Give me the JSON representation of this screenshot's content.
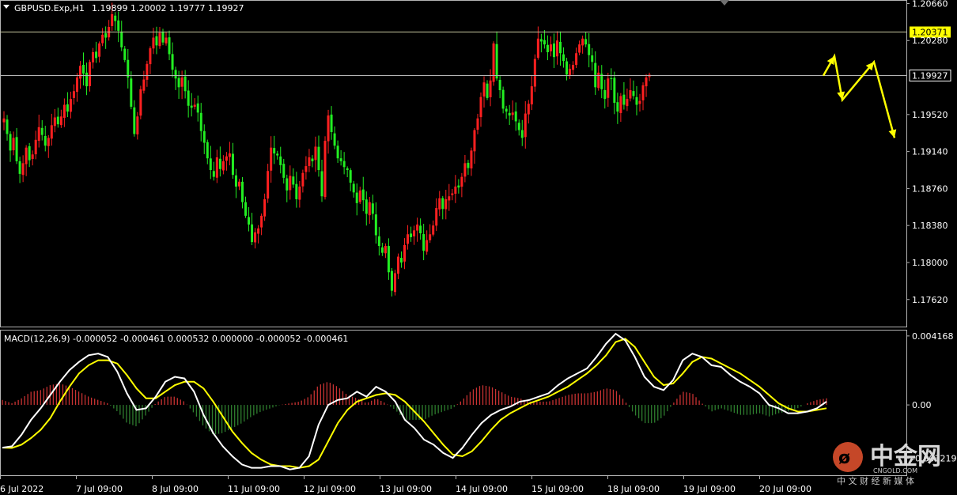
{
  "header": {
    "symbol_label": "GBPUSD.Exp,H1",
    "ohlc_label": "1.19899 1.20002 1.19777 1.19927"
  },
  "macd": {
    "label": "MACD(12,26,9) -0.000052 -0.000461 0.000532 0.000000 -0.000052 -0.000461"
  },
  "watermark": {
    "name": "中金网",
    "sub": "CNGOLD.COM",
    "tagline": "中 文 财 经 新 媒 体"
  },
  "colors": {
    "background": "#000000",
    "bull": "#ff2020",
    "bear": "#22ee22",
    "grid": "#b4b4b4",
    "macd_main": "#ffffff",
    "macd_signal": "#ffff00",
    "hist_pos": "#c83232",
    "hist_neg": "#2e7d2e",
    "arrow": "#ffff00",
    "level_highlight": "#ffff00"
  },
  "chart_data": [
    {
      "type": "candlestick",
      "title": "GBPUSD.Exp,H1",
      "ylim": [
        1.1735,
        1.2068
      ],
      "y_ticks": [
        "1.20660",
        "1.20280",
        "1.19520",
        "1.19140",
        "1.18760",
        "1.18380",
        "1.18000",
        "1.17620"
      ],
      "y_tick_values": [
        1.2066,
        1.2028,
        1.1952,
        1.1914,
        1.1876,
        1.1838,
        1.18,
        1.1762
      ],
      "x_ticks": [
        "6 Jul 2022",
        "7 Jul 09:00",
        "8 Jul 09:00",
        "11 Jul 09:00",
        "12 Jul 09:00",
        "13 Jul 09:00",
        "14 Jul 09:00",
        "15 Jul 09:00",
        "18 Jul 09:00",
        "19 Jul 09:00",
        "20 Jul 09:00"
      ],
      "x_tick_index": [
        0,
        24,
        48,
        72,
        96,
        120,
        144,
        168,
        192,
        216,
        240
      ],
      "levels": [
        {
          "value": 1.20371,
          "label": "1.20371",
          "highlight": true
        },
        {
          "value": 1.19927,
          "label": "1.19927",
          "highlight": false
        }
      ],
      "guide_points": [
        [
          1.1992,
          1.2012,
          1.1967,
          1.2006,
          1.1928
        ]
      ],
      "close": [
        1.1948,
        1.1932,
        1.1915,
        1.1928,
        1.1904,
        1.1891,
        1.1902,
        1.1918,
        1.1905,
        1.1911,
        1.1926,
        1.1939,
        1.1931,
        1.192,
        1.1928,
        1.1941,
        1.1949,
        1.1942,
        1.195,
        1.1962,
        1.1955,
        1.1968,
        1.1976,
        1.199,
        1.2002,
        1.1994,
        1.1981,
        1.2006,
        1.2016,
        1.201,
        1.2025,
        1.2034,
        1.2031,
        1.2042,
        1.2055,
        1.2048,
        1.2038,
        1.2021,
        1.2008,
        1.199,
        1.196,
        1.1932,
        1.195,
        1.1978,
        1.1988,
        1.2004,
        1.202,
        1.2031,
        1.2023,
        1.2036,
        1.2026,
        1.2031,
        1.2014,
        1.1998,
        1.1989,
        1.198,
        1.199,
        1.1976,
        1.1961,
        1.1959,
        1.1962,
        1.1954,
        1.1935,
        1.1923,
        1.1907,
        1.1895,
        1.1888,
        1.1908,
        1.1896,
        1.1904,
        1.1909,
        1.1912,
        1.189,
        1.1878,
        1.1883,
        1.1862,
        1.1848,
        1.1839,
        1.1821,
        1.1831,
        1.1835,
        1.1848,
        1.1865,
        1.1894,
        1.1918,
        1.1912,
        1.191,
        1.19,
        1.1887,
        1.1874,
        1.1889,
        1.188,
        1.1865,
        1.1878,
        1.1892,
        1.1899,
        1.1908,
        1.1904,
        1.1919,
        1.1895,
        1.1868,
        1.1925,
        1.1951,
        1.1934,
        1.192,
        1.1907,
        1.1904,
        1.1898,
        1.1895,
        1.1882,
        1.1872,
        1.1861,
        1.1874,
        1.1864,
        1.185,
        1.1862,
        1.185,
        1.1828,
        1.1817,
        1.181,
        1.1817,
        1.179,
        1.1771,
        1.1789,
        1.1806,
        1.18,
        1.1818,
        1.1829,
        1.1826,
        1.1833,
        1.1839,
        1.183,
        1.1812,
        1.1823,
        1.1829,
        1.1838,
        1.1856,
        1.1866,
        1.1855,
        1.1865,
        1.1868,
        1.1871,
        1.1878,
        1.1877,
        1.1888,
        1.1902,
        1.1897,
        1.1915,
        1.1936,
        1.1948,
        1.197,
        1.1985,
        1.1969,
        1.1987,
        1.2025,
        1.1989,
        1.1977,
        1.1958,
        1.1955,
        1.1951,
        1.1954,
        1.1945,
        1.1936,
        1.1928,
        1.1953,
        1.1963,
        1.1981,
        1.2009,
        1.203,
        1.2027,
        1.2024,
        1.2016,
        1.2024,
        1.2011,
        1.2028,
        1.2015,
        1.2007,
        1.1993,
        1.1999,
        1.2003,
        1.2015,
        1.2024,
        1.203,
        1.2024,
        1.2013,
        1.2006,
        1.198,
        1.1995,
        1.1978,
        1.1968,
        1.1989,
        1.1989,
        1.1964,
        1.1955,
        1.1971,
        1.1962,
        1.1968,
        1.1977,
        1.1971,
        1.1962,
        1.1966,
        1.1982,
        1.199,
        1.1993
      ],
      "series": [
        {
          "name": "MACD main",
          "values": [
            -0.00258,
            -0.0025,
            -0.0018,
            -0.0009,
            -0.0002,
            0.0006,
            0.0014,
            0.0021,
            0.0026,
            0.003,
            0.0031,
            0.0029,
            0.002,
            0.0007,
            -0.0003,
            -0.0002,
            0.0005,
            0.0014,
            0.0017,
            0.0016,
            0.0008,
            -0.0006,
            -0.0017,
            -0.0025,
            -0.0031,
            -0.0036,
            -0.0038,
            -0.0038,
            -0.0037,
            -0.0037,
            -0.0039,
            -0.0038,
            -0.0031,
            -0.0012,
            0,
            0.0003,
            0.0004,
            0.0008,
            0.0005,
            0.0011,
            0.0008,
            0.0002,
            -0.0009,
            -0.0014,
            -0.0021,
            -0.0024,
            -0.0029,
            -0.0032,
            -0.0026,
            -0.0018,
            -0.0011,
            -0.0006,
            -0.0003,
            -0.0001,
            0.0002,
            0.0003,
            0.0005,
            0.0007,
            0.0012,
            0.0016,
            0.0019,
            0.0022,
            0.0029,
            0.0037,
            0.0043,
            0.0039,
            0.0029,
            0.0017,
            0.0011,
            0.0009,
            0.0015,
            0.0027,
            0.0031,
            0.0029,
            0.0024,
            0.0023,
            0.0018,
            0.0014,
            0.0011,
            0.0007,
            0,
            -0.0002,
            -0.0005,
            -0.0005,
            -0.0004,
            -0.0002,
            0.0002
          ]
        },
        {
          "name": "MACD signal",
          "values": [
            -0.00258,
            -0.0026,
            -0.0024,
            -0.002,
            -0.0015,
            -0.0008,
            0.0002,
            0.0011,
            0.0019,
            0.0024,
            0.0027,
            0.0027,
            0.0025,
            0.0018,
            0.001,
            0.0004,
            0.0004,
            0.0008,
            0.0012,
            0.0014,
            0.0014,
            0.001,
            0.0002,
            -0.0007,
            -0.0016,
            -0.0023,
            -0.0029,
            -0.0033,
            -0.0036,
            -0.0037,
            -0.0037,
            -0.0038,
            -0.0037,
            -0.0033,
            -0.0022,
            -0.0011,
            -0.0003,
            0.0002,
            0.0004,
            0.0006,
            0.0007,
            0.0006,
            0.0002,
            -0.0004,
            -0.001,
            -0.0017,
            -0.0024,
            -0.003,
            -0.0031,
            -0.0028,
            -0.0022,
            -0.0015,
            -0.0009,
            -0.0005,
            -0.0002,
            0.0001,
            0.0003,
            0.0005,
            0.0008,
            0.0011,
            0.0015,
            0.0019,
            0.0024,
            0.003,
            0.0038,
            0.004,
            0.0035,
            0.0026,
            0.0017,
            0.0012,
            0.0013,
            0.0019,
            0.0026,
            0.0029,
            0.0028,
            0.0025,
            0.0022,
            0.0019,
            0.0015,
            0.0011,
            0.0006,
            0.0001,
            -0.0002,
            -0.0004,
            -0.0004,
            -0.0003,
            -0.0002
          ]
        },
        {
          "name": "histogram",
          "values": [
            0.0003,
            0.0001,
            0.0004,
            0.0008,
            0.0009,
            0.0012,
            0.0013,
            0.0011,
            0.0008,
            0.0005,
            0.0003,
            0.0001,
            -0.0004,
            -0.0011,
            -0.0013,
            -0.0006,
            0.0001,
            0.0005,
            0.0005,
            0.0002,
            -0.0005,
            -0.0013,
            -0.0018,
            -0.0017,
            -0.0014,
            -0.0011,
            -0.0007,
            -0.0004,
            -0.0002,
            0,
            0.0001,
            0.0002,
            0.0005,
            0.0012,
            0.0014,
            0.0011,
            0.0006,
            0.0004,
            0.0001,
            0.0004,
            0.0001,
            -0.0003,
            -0.0009,
            -0.0009,
            -0.0009,
            -0.0006,
            -0.0004,
            -0.0002,
            0.0003,
            0.0009,
            0.0012,
            0.0011,
            0.0008,
            0.0005,
            0.0004,
            0.0002,
            0.0002,
            0.0002,
            0.0004,
            0.0006,
            0.0007,
            0.0007,
            0.0008,
            0.001,
            0.0009,
            0.0002,
            -0.0006,
            -0.0011,
            -0.0011,
            -0.0007,
            0.0001,
            0.0008,
            0.0007,
            0.0001,
            -0.0004,
            -0.0002,
            -0.0004,
            -0.0006,
            -0.0006,
            -0.0005,
            -0.0007,
            -0.0005,
            -0.0004,
            -0.0002,
            0.0001,
            0.0003,
            0.0004
          ]
        }
      ]
    },
    {
      "type": "line",
      "title": "MACD(12,26,9)",
      "ylim": [
        -0.0042,
        0.0044
      ],
      "y_ticks": [
        "0.004168",
        "0.00",
        "-0.003219"
      ],
      "y_tick_values": [
        0.004168,
        0,
        -0.003219
      ]
    }
  ]
}
